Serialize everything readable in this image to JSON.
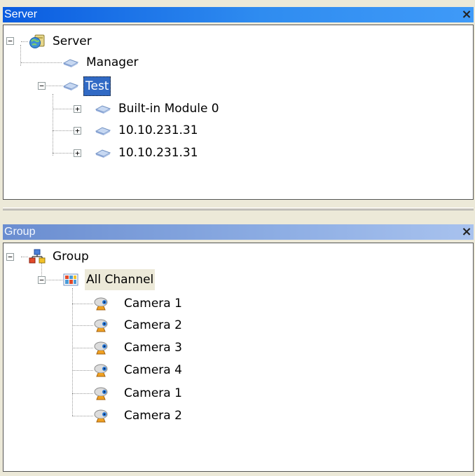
{
  "server_panel": {
    "title": "Server",
    "close_label": "×",
    "tree": {
      "root": "Server",
      "manager": "Manager",
      "test": "Test",
      "children": [
        "Built-in Module 0",
        "10.10.231.31",
        "10.10.231.31"
      ]
    }
  },
  "group_panel": {
    "title": "Group",
    "close_label": "×",
    "tree": {
      "root": "Group",
      "all_channel": "All Channel",
      "cameras": [
        "Camera 1",
        "Camera 2",
        "Camera 3",
        "Camera 4",
        "Camera 1",
        "Camera 2"
      ]
    }
  },
  "expander": {
    "collapse": "−",
    "expand": "+"
  },
  "colors": {
    "title_active": "#0a5ce0",
    "title_inactive": "#6a8dd0",
    "selection": "#316ac5"
  }
}
